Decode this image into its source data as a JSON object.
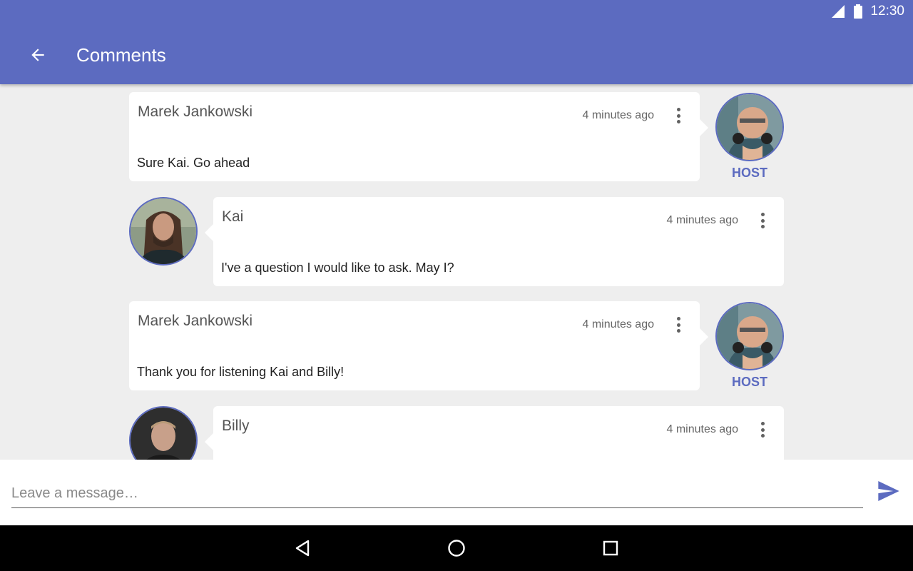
{
  "status_bar": {
    "time": "12:30"
  },
  "app_bar": {
    "title": "Comments",
    "color": "#5c6bc0"
  },
  "comments": [
    {
      "author": "Marek Jankowski",
      "time": "4 minutes ago",
      "message": "Sure Kai. Go ahead",
      "role": "HOST",
      "side": "right",
      "avatar": "host-avatar"
    },
    {
      "author": "Kai",
      "time": "4 minutes ago",
      "message": "I've a question I would like to ask. May I?",
      "role": "",
      "side": "left",
      "avatar": "kai-avatar"
    },
    {
      "author": "Marek Jankowski",
      "time": "4 minutes ago",
      "message": "Thank you for listening Kai and Billy!",
      "role": "HOST",
      "side": "right",
      "avatar": "host-avatar"
    },
    {
      "author": "Billy",
      "time": "4 minutes ago",
      "message": "",
      "role": "",
      "side": "left",
      "avatar": "billy-avatar"
    }
  ],
  "composer": {
    "placeholder": "Leave a message…",
    "value": ""
  },
  "icons": {
    "back": "arrow-back-icon",
    "send": "send-icon",
    "menu": "more-vert-icon",
    "nav_back": "triangle-back-icon",
    "nav_home": "circle-home-icon",
    "nav_recents": "square-recents-icon"
  }
}
